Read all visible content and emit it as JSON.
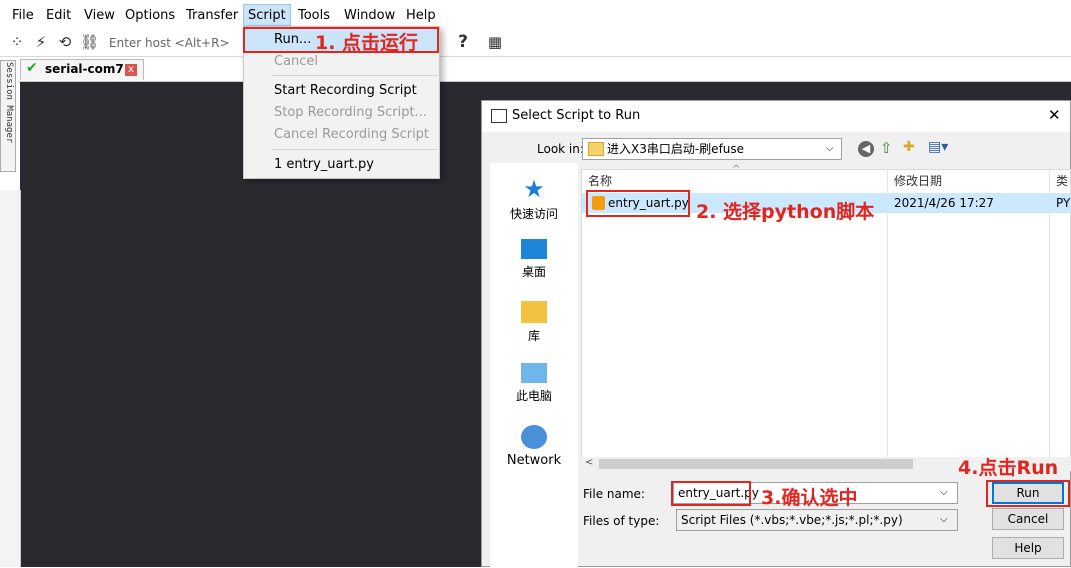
{
  "menubar": {
    "items": [
      "File",
      "Edit",
      "View",
      "Options",
      "Transfer",
      "Script",
      "Tools",
      "Window",
      "Help"
    ],
    "active": "Script"
  },
  "toolbar": {
    "host_placeholder": "Enter host <Alt+R>",
    "help_glyph": "?"
  },
  "session_manager": {
    "label": "Session Manager"
  },
  "tab": {
    "name": "serial-com7",
    "close": "x"
  },
  "script_menu": {
    "run": "Run...",
    "cancel": "Cancel",
    "start_recording": "Start Recording Script",
    "stop_recording": "Stop Recording Script...",
    "cancel_recording": "Cancel Recording Script",
    "recent": "1 entry_uart.py"
  },
  "dialog": {
    "title": "Select Script to Run",
    "close": "✕",
    "look_in_label": "Look in:",
    "look_in_value": "进入X3串口启动-刷efuse",
    "places": [
      "快速访问",
      "桌面",
      "库",
      "此电脑",
      "Network"
    ],
    "columns": [
      "名称",
      "修改日期",
      "类"
    ],
    "file": {
      "name": "entry_uart.py",
      "date": "2021/4/26 17:27",
      "type": "PY"
    },
    "file_name_label": "File name:",
    "file_name_value": "entry_uart.py",
    "file_type_label": "Files of type:",
    "file_type_value": "Script Files (*.vbs;*.vbe;*.js;*.pl;*.py)",
    "buttons": {
      "run": "Run",
      "cancel": "Cancel",
      "help": "Help"
    }
  },
  "annotations": {
    "step1": "1. 点击运行",
    "step2": "2. 选择python脚本",
    "step3": "3.确认选中",
    "step4": "4.点击Run"
  },
  "colors": {
    "annotation": "#e0261f",
    "terminal_bg": "#2b2830",
    "selection": "#cce4f7"
  }
}
